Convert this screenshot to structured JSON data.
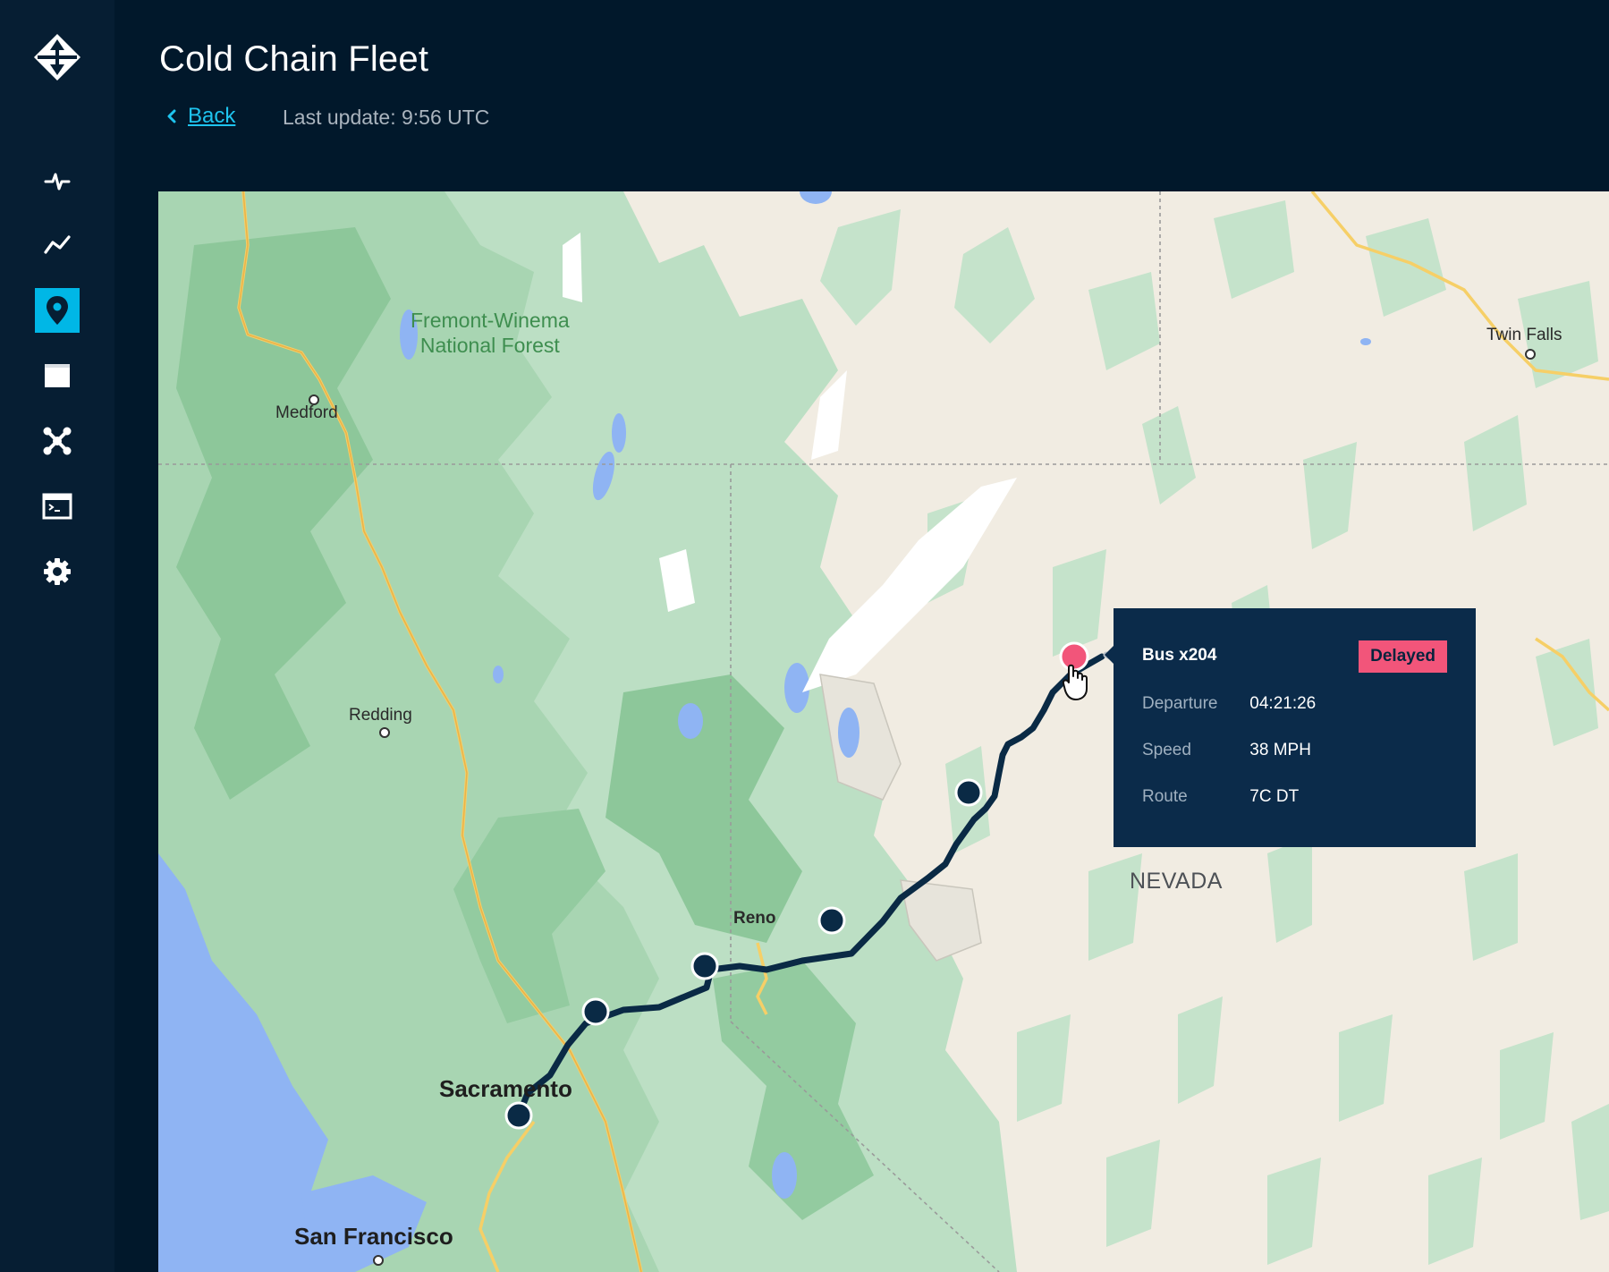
{
  "app": {
    "title": "Cold Chain Fleet",
    "back_label": "Back",
    "last_update": "Last update: 9:56 UTC"
  },
  "sidebar": {
    "logo_icon": "compass-diamond-icon",
    "items": [
      {
        "name": "pulse",
        "icon": "activity-icon",
        "active": false
      },
      {
        "name": "analytics",
        "icon": "line-chart-icon",
        "active": false
      },
      {
        "name": "map",
        "icon": "map-pin-icon",
        "active": true
      },
      {
        "name": "panel",
        "icon": "window-icon",
        "active": false
      },
      {
        "name": "network",
        "icon": "network-icon",
        "active": false
      },
      {
        "name": "console",
        "icon": "terminal-icon",
        "active": false
      },
      {
        "name": "settings",
        "icon": "gear-icon",
        "active": false
      }
    ],
    "active_color": "#00b7e6"
  },
  "map": {
    "labels": {
      "forest": "Fremont-Winema\nNational Forest",
      "medford": "Medford",
      "redding": "Redding",
      "reno": "Reno",
      "sacramento": "Sacramento",
      "san_francisco": "San Francisco",
      "twin_falls": "Twin Falls",
      "nevada": "NEVADA"
    },
    "route_color": "#0a2a45",
    "alert_color": "#f2557a"
  },
  "tooltip": {
    "title": "Bus x204",
    "status": "Delayed",
    "rows": [
      {
        "key": "Departure",
        "value": "04:21:26"
      },
      {
        "key": "Speed",
        "value": "38 MPH"
      },
      {
        "key": "Route",
        "value": "7C DT"
      }
    ]
  }
}
